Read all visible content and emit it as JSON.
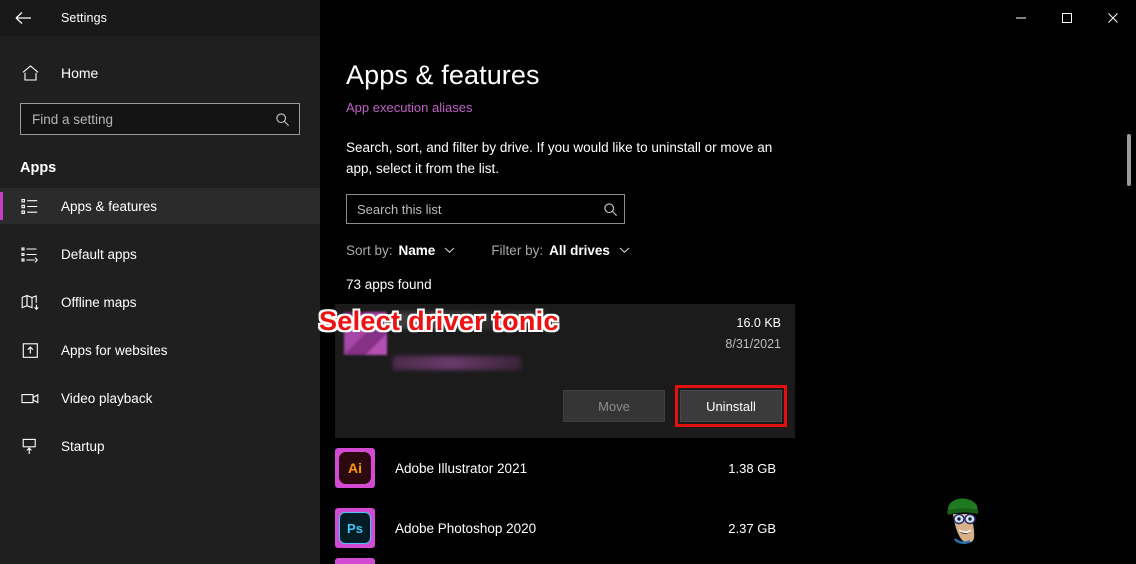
{
  "window": {
    "title": "Settings",
    "back_icon": "back-arrow-icon",
    "minimize_label": "Minimize",
    "maximize_label": "Maximize",
    "close_label": "Close"
  },
  "sidebar": {
    "home_label": "Home",
    "home_icon": "home-icon",
    "find_placeholder": "Find a setting",
    "find_value": "",
    "search_icon": "search-icon",
    "section_label": "Apps",
    "accent_color": "#c23ec2",
    "items": [
      {
        "label": "Apps & features",
        "icon": "apps-list-icon",
        "active": true
      },
      {
        "label": "Default apps",
        "icon": "default-apps-icon",
        "active": false
      },
      {
        "label": "Offline maps",
        "icon": "map-download-icon",
        "active": false
      },
      {
        "label": "Apps for websites",
        "icon": "apps-websites-icon",
        "active": false
      },
      {
        "label": "Video playback",
        "icon": "video-camera-icon",
        "active": false
      },
      {
        "label": "Startup",
        "icon": "startup-icon",
        "active": false
      }
    ]
  },
  "main": {
    "page_title": "Apps & features",
    "alias_link": "App execution aliases",
    "alias_link_color": "#c160c8",
    "description": "Search, sort, and filter by drive. If you would like to uninstall or move an app, select it from the list.",
    "list_search_placeholder": "Search this list",
    "list_search_value": "",
    "list_search_icon": "search-icon",
    "sort_by_label": "Sort by:",
    "sort_by_value": "Name",
    "filter_by_label": "Filter by:",
    "filter_by_value": "All drives",
    "chevron_icon": "chevron-down-icon",
    "apps_found": "73 apps found"
  },
  "selected_app": {
    "name_obscured": true,
    "size": "16.0 KB",
    "date": "8/31/2021",
    "move_label": "Move",
    "move_disabled": true,
    "uninstall_label": "Uninstall",
    "uninstall_highlight_color": "#e31010"
  },
  "apps": [
    {
      "name": "Adobe Illustrator 2021",
      "size": "1.38 GB",
      "icon": "adobe-illustrator-icon",
      "icon_text": "Ai"
    },
    {
      "name": "Adobe Photoshop 2020",
      "size": "2.37 GB",
      "icon": "adobe-photoshop-icon",
      "icon_text": "Ps"
    }
  ],
  "annotation": {
    "text": "Select driver tonic",
    "color": "#ee1111",
    "outline_color": "#ffffff"
  },
  "watermark": {
    "name": "cartoon-character-watermark"
  }
}
